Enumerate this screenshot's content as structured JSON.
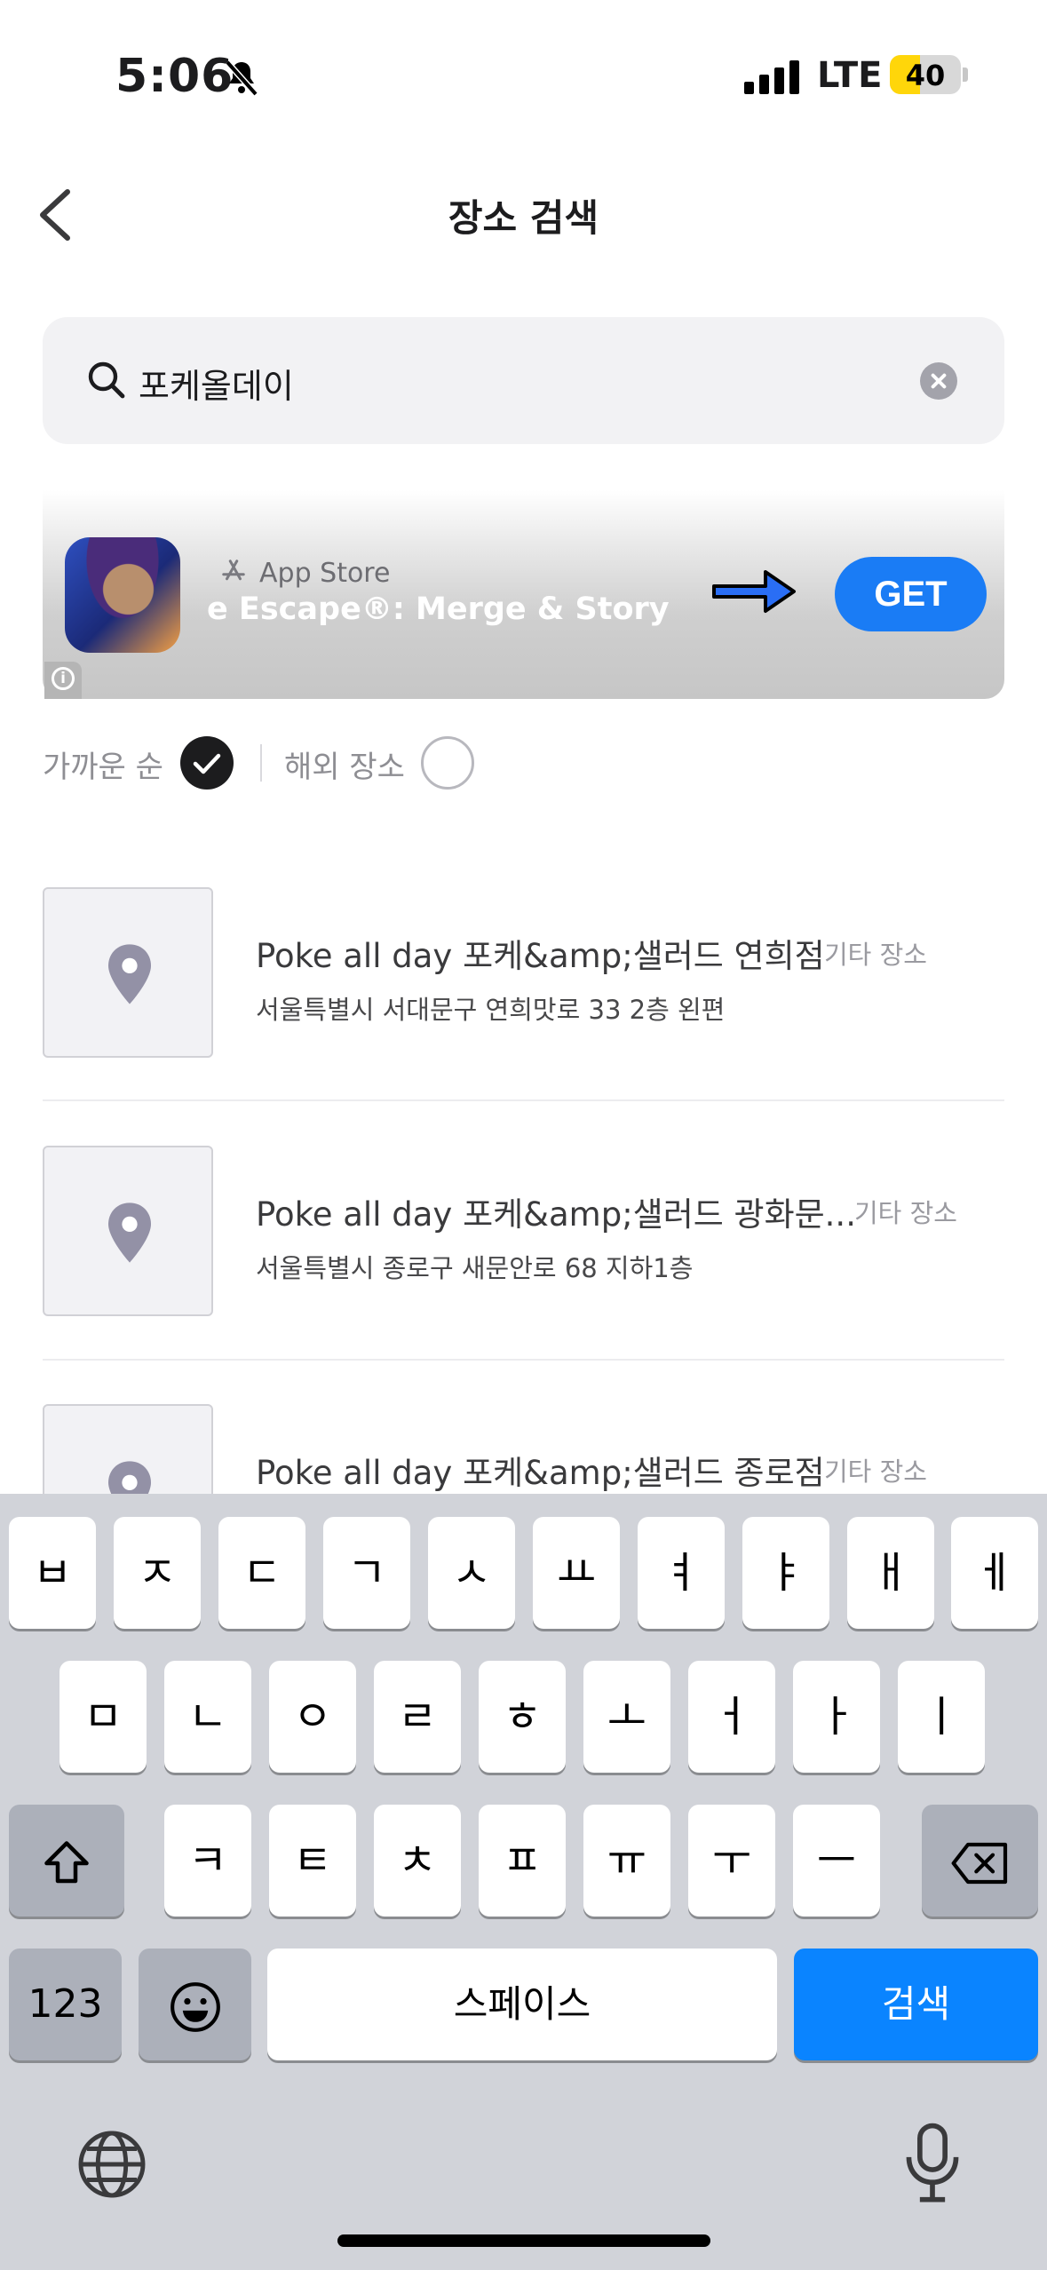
{
  "status": {
    "time": "5:06",
    "network": "LTE",
    "battery": "40",
    "battery_level": 0.4
  },
  "header": {
    "title": "장소 검색"
  },
  "search": {
    "query": "포케올데이"
  },
  "ad": {
    "store_label": "App Store",
    "app_name": "e Escape®: Merge & Story",
    "cta": "GET"
  },
  "filters": {
    "nearest": "가까운 순",
    "overseas": "해외 장소",
    "nearest_selected": true,
    "overseas_selected": false
  },
  "results": [
    {
      "name": "Poke all day 포케&amp;샐러드 연희점",
      "category": "기타 장소",
      "address": "서울특별시 서대문구 연희맛로 33 2층 왼편"
    },
    {
      "name": "Poke all day 포케&amp;샐러드 광화문...",
      "category": "기타 장소",
      "address": "서울특별시 종로구 새문안로 68 지하1층"
    },
    {
      "name": "Poke all day 포케&amp;샐러드 종로점",
      "category": "기타 장소",
      "address": ""
    }
  ],
  "keyboard": {
    "row1": [
      "ㅂ",
      "ㅈ",
      "ㄷ",
      "ㄱ",
      "ㅅ",
      "ㅛ",
      "ㅕ",
      "ㅑ",
      "ㅐ",
      "ㅔ"
    ],
    "row2": [
      "ㅁ",
      "ㄴ",
      "ㅇ",
      "ㄹ",
      "ㅎ",
      "ㅗ",
      "ㅓ",
      "ㅏ",
      "ㅣ"
    ],
    "row3": [
      "ㅋ",
      "ㅌ",
      "ㅊ",
      "ㅍ",
      "ㅠ",
      "ㅜ",
      "ㅡ"
    ],
    "numbers": "123",
    "space": "스페이스",
    "search": "검색"
  },
  "colors": {
    "accent": "#1a7cf5",
    "keyboard_bg": "#d1d3d9",
    "return_key": "#0a84ff"
  }
}
